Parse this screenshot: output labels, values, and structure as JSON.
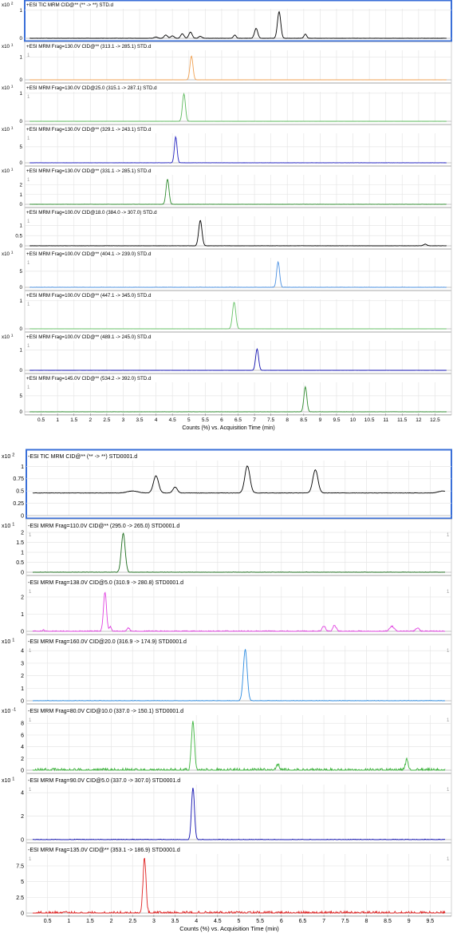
{
  "charts": [
    {
      "id": "positive",
      "xlabel": "Counts (%) vs. Acquisition Time (min)",
      "xlim": [
        0,
        13.0
      ],
      "xticks": [
        "0.5",
        "1",
        "1.5",
        "2",
        "2.5",
        "3",
        "3.5",
        "4",
        "4.5",
        "5",
        "5.5",
        "6",
        "6.5",
        "7",
        "7.5",
        "8",
        "8.5",
        "9",
        "9.5",
        "10",
        "10.5",
        "11",
        "11.5",
        "12",
        "12.5"
      ],
      "panels": [
        {
          "title": "+ESI TIC MRM CID@** (** -> **) STD.d",
          "exp": "x10 2",
          "yticks": [
            "1",
            "0"
          ],
          "ylim": [
            0,
            1.05
          ],
          "color": "#000000",
          "selected": true,
          "flag_left": "",
          "flag_right": "",
          "peaks": [
            [
              4.0,
              0.05,
              0.05
            ],
            [
              4.3,
              0.12,
              0.05
            ],
            [
              4.5,
              0.09,
              0.05
            ],
            [
              4.8,
              0.16,
              0.05
            ],
            [
              5.05,
              0.22,
              0.05
            ],
            [
              5.35,
              0.07,
              0.05
            ],
            [
              6.4,
              0.12,
              0.04
            ],
            [
              7.05,
              0.35,
              0.05
            ],
            [
              7.75,
              0.95,
              0.05
            ],
            [
              8.55,
              0.15,
              0.04
            ]
          ],
          "noise": 0.015
        },
        {
          "title": "+ESI MRM Frag=130.0V CID@** (313.1 -> 285.1) STD.d",
          "exp": "x10 1",
          "yticks": [
            "1",
            "0"
          ],
          "ylim": [
            0,
            1.3
          ],
          "color": "#f0a050",
          "selected": false,
          "flag_left": "1",
          "flag_right": "",
          "peaks": [
            [
              5.08,
              1.05,
              0.045
            ]
          ],
          "noise": 0.004
        },
        {
          "title": "+ESI MRM Frag=130.0V CID@25.0 (315.1 -> 287.1) STD.d",
          "exp": "x10 1",
          "yticks": [
            "1",
            "0"
          ],
          "ylim": [
            0,
            1.05
          ],
          "color": "#5bb85b",
          "selected": false,
          "flag_left": "1",
          "flag_right": "",
          "peaks": [
            [
              4.85,
              0.98,
              0.045
            ]
          ],
          "noise": 0.004
        },
        {
          "title": "+ESI MRM Frag=130.0V CID@** (329.1 -> 243.1) STD.d",
          "exp": "x10 1",
          "yticks": [
            "5",
            "0"
          ],
          "ylim": [
            0,
            9.2
          ],
          "color": "#2020c0",
          "selected": false,
          "flag_left": "1",
          "flag_right": "",
          "peaks": [
            [
              4.6,
              8.1,
              0.04
            ]
          ],
          "noise": 0.02
        },
        {
          "title": "+ESI MRM Frag=130.0V CID@** (331.1 -> 285.1) STD.d",
          "exp": "x10 1",
          "yticks": [
            "2",
            "1",
            "0"
          ],
          "ylim": [
            0,
            3.0
          ],
          "color": "#2e8b2e",
          "selected": false,
          "flag_left": "1",
          "flag_right": "",
          "peaks": [
            [
              4.35,
              2.55,
              0.045
            ]
          ],
          "noise": 0.02
        },
        {
          "title": "+ESI MRM Frag=100.0V CID@18.0 (384.0 -> 307.0) STD.d",
          "exp": "",
          "yticks": [
            "1",
            "0.5",
            "0"
          ],
          "ylim": [
            0,
            1.45
          ],
          "color": "#000000",
          "selected": false,
          "flag_left": "1",
          "flag_right": "",
          "peaks": [
            [
              5.35,
              1.25,
              0.05
            ],
            [
              12.2,
              0.08,
              0.05
            ]
          ],
          "noise": 0.02
        },
        {
          "title": "+ESI MRM Frag=100.0V CID@** (404.1 -> 239.0) STD.d",
          "exp": "x10 1",
          "yticks": [
            "5",
            "0"
          ],
          "ylim": [
            0,
            9.2
          ],
          "color": "#4a90e2",
          "selected": false,
          "flag_left": "1",
          "flag_right": "",
          "peaks": [
            [
              7.72,
              7.9,
              0.045
            ]
          ],
          "noise": 0.03
        },
        {
          "title": "+ESI MRM Frag=100.0V CID@** (447.1 -> 345.0) STD.d",
          "exp": "",
          "yticks": [
            "1",
            "0"
          ],
          "ylim": [
            0,
            1.05
          ],
          "color": "#66c266",
          "selected": false,
          "flag_left": "1",
          "flag_right": "",
          "peaks": [
            [
              6.38,
              0.95,
              0.05
            ]
          ],
          "noise": 0.004
        },
        {
          "title": "+ESI MRM Frag=100.0V CID@** (489.1 -> 245.0) STD.d",
          "exp": "x10 1",
          "yticks": [
            "1",
            "0"
          ],
          "ylim": [
            0,
            1.45
          ],
          "color": "#1010b0",
          "selected": false,
          "flag_left": "1",
          "flag_right": "",
          "peaks": [
            [
              7.08,
              1.05,
              0.045
            ]
          ],
          "noise": 0.004
        },
        {
          "title": "+ESI MRM Frag=145.0V CID@** (534.2 -> 392.0) STD.d",
          "exp": "",
          "yticks": [
            "5",
            "0"
          ],
          "ylim": [
            0,
            9.2
          ],
          "color": "#2e8b2e",
          "selected": false,
          "flag_left": "1",
          "flag_right": "",
          "peaks": [
            [
              8.55,
              7.8,
              0.045
            ]
          ],
          "noise": 0.02
        }
      ]
    },
    {
      "id": "negative",
      "xlabel": "Counts (%) vs. Acquisition Time (min)",
      "xlim": [
        0,
        10.0
      ],
      "xticks": [
        "0.5",
        "1",
        "1.5",
        "2",
        "2.5",
        "3",
        "3.5",
        "4",
        "4.5",
        "5",
        "5.5",
        "6",
        "6.5",
        "7",
        "7.5",
        "8",
        "8.5",
        "9",
        "9.5"
      ],
      "panels": [
        {
          "title": "-ESI TIC MRM CID@** (** -> **) STD0001.d",
          "exp": "x10 2",
          "yticks": [
            "1",
            "0.75",
            "0.5",
            "0.25",
            "0"
          ],
          "ylim": [
            0,
            1.12
          ],
          "color": "#000000",
          "selected": true,
          "flag_left": "",
          "flag_right": "",
          "baseline": 0.46,
          "peaks": [
            [
              2.5,
              0.04,
              0.12
            ],
            [
              3.05,
              0.35,
              0.06
            ],
            [
              3.5,
              0.12,
              0.05
            ],
            [
              5.2,
              0.55,
              0.06
            ],
            [
              6.8,
              0.47,
              0.06
            ],
            [
              9.8,
              0.04,
              0.1
            ]
          ],
          "noise": 0.01
        },
        {
          "title": "-ESI MRM Frag=110.0V CID@** (295.0 -> 265.0) STD0001.d",
          "exp": "x10 1",
          "yticks": [
            "2",
            "1.5",
            "1",
            "0.5",
            "0"
          ],
          "ylim": [
            0,
            2.12
          ],
          "color": "#1a6b1a",
          "selected": false,
          "flag_left": "1",
          "flag_right": "1",
          "peaks": [
            [
              2.28,
              1.95,
              0.045
            ]
          ],
          "noise": 0.025
        },
        {
          "title": "-ESI MRM Frag=138.0V CID@5.0 (310.9 -> 280.8) STD0001.d",
          "exp": "",
          "yticks": [
            "2",
            "1",
            "0"
          ],
          "ylim": [
            0,
            2.6
          ],
          "color": "#e040e0",
          "selected": false,
          "flag_left": "1",
          "flag_right": "1",
          "peaks": [
            [
              0.4,
              0.1,
              0.02
            ],
            [
              1.85,
              2.3,
              0.035
            ],
            [
              1.98,
              0.25,
              0.03
            ],
            [
              2.4,
              0.2,
              0.03
            ],
            [
              7.0,
              0.3,
              0.04
            ],
            [
              7.25,
              0.35,
              0.04
            ],
            [
              8.6,
              0.3,
              0.05
            ],
            [
              9.2,
              0.2,
              0.04
            ]
          ],
          "noise": 0.05
        },
        {
          "title": "-ESI MRM Frag=160.0V CID@20.0 (316.9 -> 174.9) STD0001.d",
          "exp": "x10 1",
          "yticks": [
            "4",
            "3",
            "2",
            "1",
            "0"
          ],
          "ylim": [
            0,
            4.4
          ],
          "color": "#2a8ae0",
          "selected": false,
          "flag_left": "1",
          "flag_right": "1",
          "peaks": [
            [
              5.15,
              4.1,
              0.045
            ]
          ],
          "noise": 0.02
        },
        {
          "title": "-ESI MRM Frag=80.0V CID@10.0 (337.0 -> 150.1) STD0001.d",
          "exp": "x10 -1",
          "yticks": [
            "8",
            "6",
            "4",
            "2",
            "0"
          ],
          "ylim": [
            0,
            9.4
          ],
          "color": "#3cb43c",
          "selected": false,
          "flag_left": "1",
          "flag_right": "1",
          "peaks": [
            [
              3.92,
              8.6,
              0.035
            ],
            [
              5.92,
              1.0,
              0.03
            ],
            [
              8.95,
              2.0,
              0.03
            ]
          ],
          "noise": 0.12
        },
        {
          "title": "-ESI MRM Frag=90.0V CID@5.0 (337.0 -> 307.0) STD0001.d",
          "exp": "x10 1",
          "yticks": [
            "4",
            "2",
            "0"
          ],
          "ylim": [
            0,
            4.7
          ],
          "color": "#1010b0",
          "selected": false,
          "flag_left": "1",
          "flag_right": "1",
          "peaks": [
            [
              3.92,
              4.45,
              0.035
            ]
          ],
          "noise": 0.03
        },
        {
          "title": "-ESI MRM Frag=135.0V CID@** (353.1 -> 186.9) STD0001.d",
          "exp": "",
          "yticks": [
            "7.5",
            "5",
            "2.5",
            "0"
          ],
          "ylim": [
            0,
            9.4
          ],
          "color": "#e02020",
          "selected": false,
          "flag_left": "1",
          "flag_right": "1",
          "peaks": [
            [
              2.78,
              8.9,
              0.035
            ]
          ],
          "noise": 0.1
        }
      ]
    }
  ]
}
